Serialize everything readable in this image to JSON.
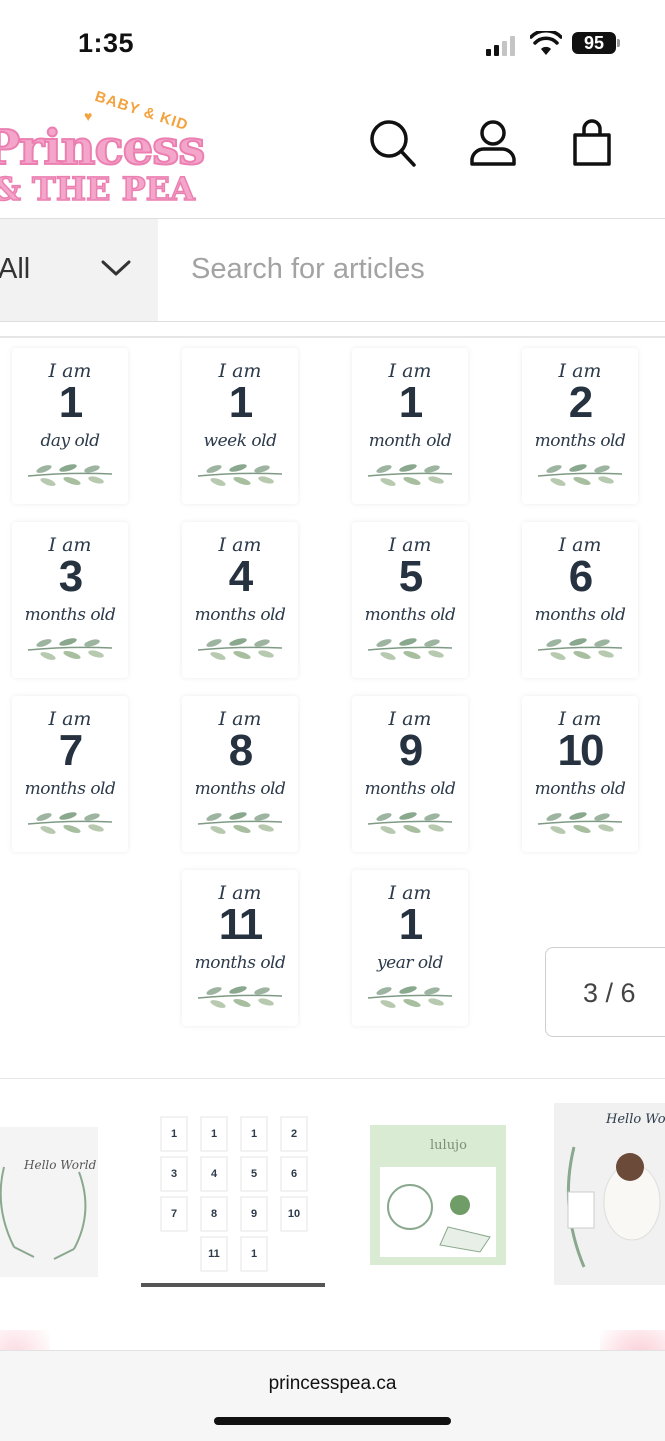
{
  "status_bar": {
    "time": "1:35",
    "battery": "95"
  },
  "header": {
    "logo": {
      "tag": "BABY & KID",
      "line1": "Princess",
      "line2": "& THE PEA"
    }
  },
  "search": {
    "category": "All",
    "placeholder": "Search for articles"
  },
  "gallery": {
    "cards": [
      {
        "prefix": "I am",
        "number": "1",
        "unit": "day old"
      },
      {
        "prefix": "I am",
        "number": "1",
        "unit": "week old"
      },
      {
        "prefix": "I am",
        "number": "1",
        "unit": "month old"
      },
      {
        "prefix": "I am",
        "number": "2",
        "unit": "months old"
      },
      {
        "prefix": "I am",
        "number": "3",
        "unit": "months old"
      },
      {
        "prefix": "I am",
        "number": "4",
        "unit": "months old"
      },
      {
        "prefix": "I am",
        "number": "5",
        "unit": "months old"
      },
      {
        "prefix": "I am",
        "number": "6",
        "unit": "months old"
      },
      {
        "prefix": "I am",
        "number": "7",
        "unit": "months old"
      },
      {
        "prefix": "I am",
        "number": "8",
        "unit": "months old"
      },
      {
        "prefix": "I am",
        "number": "9",
        "unit": "months old"
      },
      {
        "prefix": "I am",
        "number": "10",
        "unit": "months old"
      },
      {
        "prefix": "I am",
        "number": "11",
        "unit": "months old"
      },
      {
        "prefix": "I am",
        "number": "1",
        "unit": "year old"
      }
    ],
    "counter": "3 / 6"
  },
  "thumbnails": {
    "items": [
      {
        "text": "Hello World"
      },
      {
        "text": ""
      },
      {
        "text": "lulujo"
      },
      {
        "text": "Hello World"
      }
    ],
    "active_index": 1
  },
  "browser": {
    "url": "princesspea.ca"
  },
  "colors": {
    "logo_pink": "#f3a6c9",
    "logo_orange": "#f4a23d",
    "card_text": "#2c3a4a",
    "leaf_green": "#8aa88e"
  }
}
